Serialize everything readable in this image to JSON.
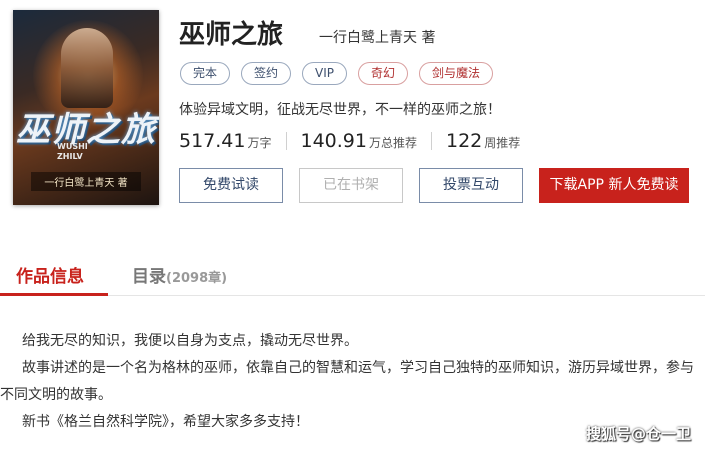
{
  "cover": {
    "title": "巫师之旅",
    "pinyin_line1": "WUSHI",
    "pinyin_line2": "ZHILV",
    "author": "一行白鹭上青天 著"
  },
  "book": {
    "title": "巫师之旅",
    "author": "一行白鹭上青天 著",
    "tags": [
      "完本",
      "签约",
      "VIP",
      "奇幻",
      "剑与魔法"
    ],
    "intro": "体验异域文明，征战无尽世界，不一样的巫师之旅！"
  },
  "stats": [
    {
      "value": "517.41",
      "unit": "万字"
    },
    {
      "value": "140.91",
      "unit": "万总推荐"
    },
    {
      "value": "122",
      "unit": "周推荐"
    }
  ],
  "buttons": {
    "free_read": "免费试读",
    "on_shelf": "已在书架",
    "vote": "投票互动",
    "download": "下载APP 新人免费读"
  },
  "tabs": {
    "info": "作品信息",
    "catalog": "目录",
    "catalog_count": "(2098章)"
  },
  "description": [
    "给我无尽的知识，我便以自身为支点，撬动无尽世界。",
    "故事讲述的是一个名为格林的巫师，依靠自己的智慧和运气，学习自己独特的巫师知识，游历异域世界，参与不同文明的故事。",
    "新书《格兰自然科学院》，希望大家多多支持！"
  ],
  "watermark": "搜狐号@仓一卫",
  "colors": {
    "accent": "#c8221c",
    "button_border": "#7a8ca8"
  }
}
